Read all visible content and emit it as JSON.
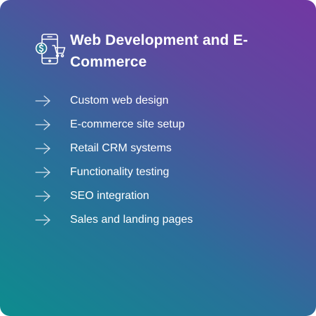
{
  "card": {
    "title": "Web Development and E-Commerce",
    "icon": "mobile-shopping-icon",
    "arrow_icon": "arrow-right-icon",
    "gradient_colors": [
      "#0d8c8e",
      "#2a6f9a",
      "#5b4a9f",
      "#7237a3"
    ],
    "items": [
      {
        "label": "Custom web design"
      },
      {
        "label": "E-commerce site setup"
      },
      {
        "label": "Retail CRM systems"
      },
      {
        "label": "Functionality testing"
      },
      {
        "label": "SEO integration"
      },
      {
        "label": "Sales and landing pages"
      }
    ]
  }
}
